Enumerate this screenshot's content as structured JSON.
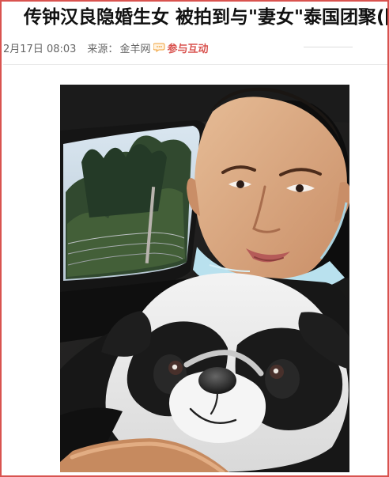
{
  "article": {
    "title": "传钟汉良隐婚生女 被拍到与\"妻女\"泰国团聚(图)",
    "date": "2月17日 08:03",
    "source_label": "来源：",
    "source_name": "金羊网",
    "interact_label": "参与互动"
  },
  "image": {
    "alt_label": ""
  },
  "colors": {
    "accent": "#d9534f",
    "meta_text": "#666666"
  },
  "icons": {
    "comment": "speech-bubble-icon"
  }
}
